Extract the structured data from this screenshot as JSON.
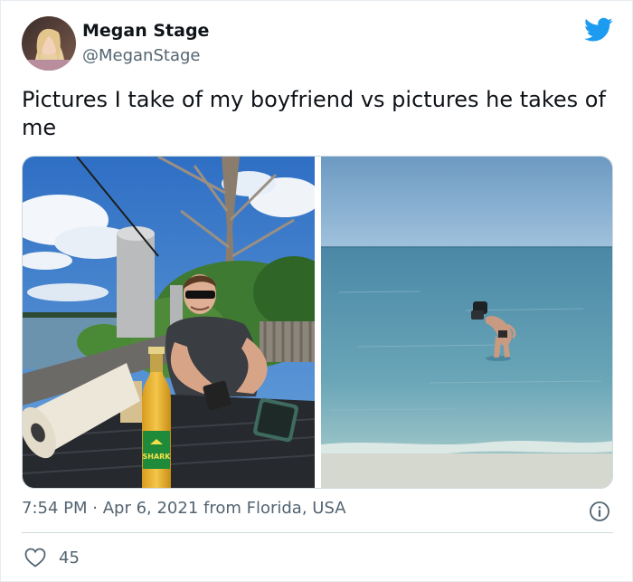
{
  "author": {
    "display_name": "Megan Stage",
    "handle": "@MeganStage"
  },
  "tweet": {
    "text": "Pictures I take of my boyfriend vs pictures he takes of me"
  },
  "meta": {
    "time": "7:54 PM",
    "separator": " · ",
    "date": "Apr 6, 2021",
    "source": " from Florida, USA"
  },
  "engagement": {
    "likes": "45"
  },
  "media": {
    "bottle_label": "SHARK"
  },
  "colors": {
    "brand": "#1d9bf0",
    "secondary_text": "#536471",
    "primary_text": "#0f1419"
  },
  "icons": {
    "brand": "twitter-bird-icon",
    "info": "info-icon",
    "like": "heart-icon"
  }
}
